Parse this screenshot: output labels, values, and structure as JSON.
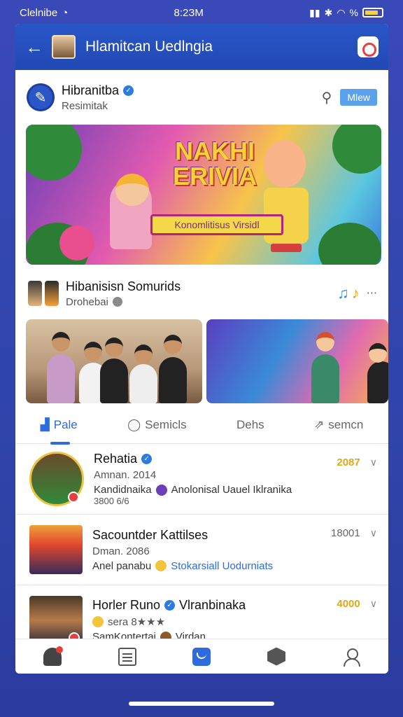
{
  "status_bar": {
    "carrier": "Clelnibe",
    "time": "8:2ЗМ",
    "battery_color": "#f5d33b"
  },
  "header": {
    "title": "Hlamitcan Uedlngia",
    "back_icon": "arrow-left-icon",
    "camera_icon": "camera-icon"
  },
  "profile": {
    "name": "Hibranitba",
    "subtitle": "Resimitak",
    "view_label": "Mlew"
  },
  "banner": {
    "title": "NAKHI ERIVIA",
    "ribbon": "Konomlitisus Virsidl"
  },
  "section": {
    "title": "Hibanisisn Somurids",
    "subtitle": "Drohebai"
  },
  "tabs": [
    {
      "label": "Pale",
      "active": true
    },
    {
      "label": "Semicls",
      "active": false
    },
    {
      "label": "Dehs",
      "active": false
    },
    {
      "label": "semcn",
      "active": false
    }
  ],
  "list": [
    {
      "name": "Rehatia",
      "meta": "Amnan. 2014",
      "meta2": "3800 6/6",
      "desc_a": "Kandidnaika",
      "desc_b": "Anolonisal Uauel Iklranika",
      "number": "2087",
      "number_color": "#e0a81a"
    },
    {
      "name": "Sacountder Kattilses",
      "meta": "Dman. 2086",
      "desc_a": "Anel panabu",
      "desc_b": "Stokarsiall Uodurniats",
      "number": "18001",
      "number_color": "#666666"
    },
    {
      "name": "Horler Runo",
      "name2": "Vlranbinaka",
      "meta": "sera 8★★★",
      "desc_a": "SamKontertai",
      "desc_b": "Virdan",
      "number": "4000",
      "number_color": "#e0a81a"
    }
  ],
  "accent_color": "#2d6be0"
}
